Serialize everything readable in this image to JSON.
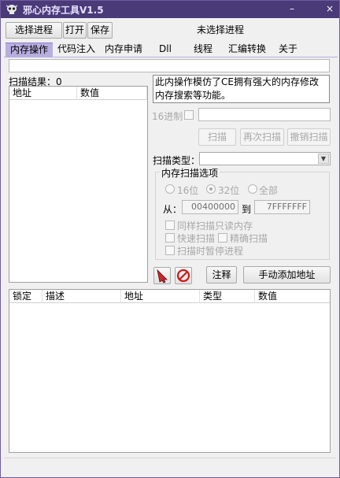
{
  "window": {
    "title": "邪心内存工具V1.5",
    "minimize_glyph": "–",
    "close_glyph": "×"
  },
  "toolbar": {
    "select_process": "选择进程",
    "open": "打开",
    "save": "保存",
    "status": "未选择进程"
  },
  "tabs": [
    {
      "label": "内存操作",
      "active": true
    },
    {
      "label": "代码注入"
    },
    {
      "label": "内存申请"
    },
    {
      "label": "Dll"
    },
    {
      "label": "线程"
    },
    {
      "label": "汇编转换"
    },
    {
      "label": "关于"
    }
  ],
  "scan_results": {
    "label": "扫描结果：0",
    "columns": [
      "地址",
      "数值"
    ]
  },
  "info_text": {
    "line1": "此内操作模仿了CE拥有强大的内存修改",
    "line2": "内存搜索等功能。"
  },
  "hex": {
    "label": "16进制"
  },
  "scan_buttons": {
    "scan": "扫描",
    "rescan": "再次扫描",
    "undo": "撤销扫描"
  },
  "scan_type": {
    "label": "扫描类型："
  },
  "memory_options": {
    "title": "内存扫描选项",
    "bits16": "16位",
    "bits32": "32位",
    "all": "全部",
    "from_label": "从：",
    "from_value": "00400000",
    "to_label": "到",
    "to_value": "7FFFFFFF",
    "same_readonly": "同样扫描只读内存",
    "fast_scan": "快速扫描",
    "precise_scan": "精确扫描",
    "pause_process": "扫描时暂停进程"
  },
  "actions": {
    "comment": "注释",
    "manual_add": "手动添加地址"
  },
  "address_list": {
    "columns": [
      "锁定",
      "描述",
      "地址",
      "类型",
      "数值"
    ]
  },
  "colors": {
    "titlebar": "#4a3a78",
    "tab_active": "#b8aee0"
  }
}
